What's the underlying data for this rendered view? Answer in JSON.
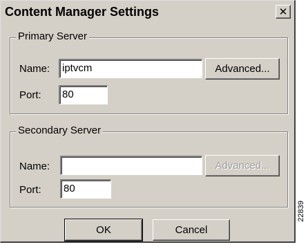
{
  "window": {
    "title": "Content Manager Settings"
  },
  "primary": {
    "group_label": "Primary Server",
    "name_label": "Name:",
    "name_value": "iptvcm",
    "advanced_label": "Advanced...",
    "port_label": "Port:",
    "port_value": "80"
  },
  "secondary": {
    "group_label": "Secondary Server",
    "name_label": "Name:",
    "name_value": "",
    "advanced_label": "Advanced...",
    "port_label": "Port:",
    "port_value": "80"
  },
  "buttons": {
    "ok": "OK",
    "cancel": "Cancel"
  },
  "figure_code": "22839",
  "icons": {
    "close": "close-icon"
  }
}
